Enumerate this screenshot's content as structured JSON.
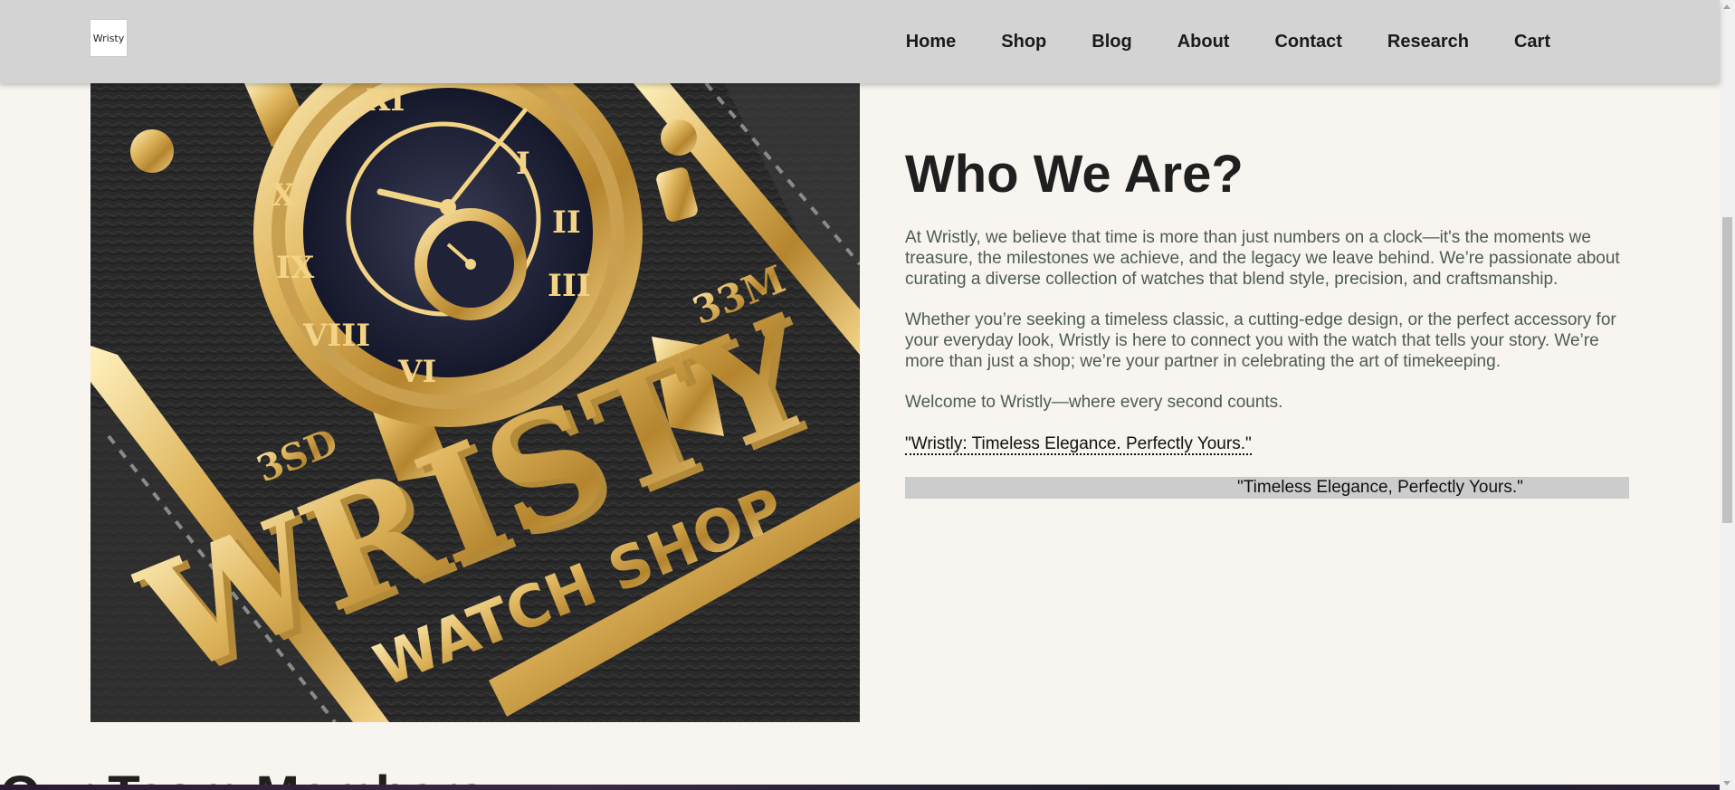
{
  "navbar": {
    "logo_text": "Wristy",
    "links": [
      "Home",
      "Shop",
      "Blog",
      "About",
      "Contact",
      "Research",
      "Cart"
    ]
  },
  "hero": {
    "logo_main": "WRISTY",
    "logo_sub": "WATCH SHOP",
    "badge_left": "3SD",
    "badge_right": "33M"
  },
  "about": {
    "title": "Who We Are?",
    "paragraph_1": "At Wristly, we believe that time is more than just numbers on a clock—it's the moments we treasure, the milestones we achieve, and the legacy we leave behind. We’re passionate about curating a diverse collection of watches that blend style, precision, and craftsmanship.",
    "paragraph_2": "Whether you’re seeking a timeless classic, a cutting-edge design, or the perfect accessory for your everyday look, Wristly is here to connect you with the watch that tells your story. We’re more than just a shop; we’re your partner in celebrating the art of timekeeping.",
    "paragraph_3": "Welcome to Wristly—where every second counts.",
    "slogan_link": "\"Wristly: Timeless Elegance. Perfectly Yours.\"",
    "marquee": "\"Timeless Elegance, Perfectly Yours.\""
  },
  "next_section": {
    "heading": "Our Team Members"
  }
}
